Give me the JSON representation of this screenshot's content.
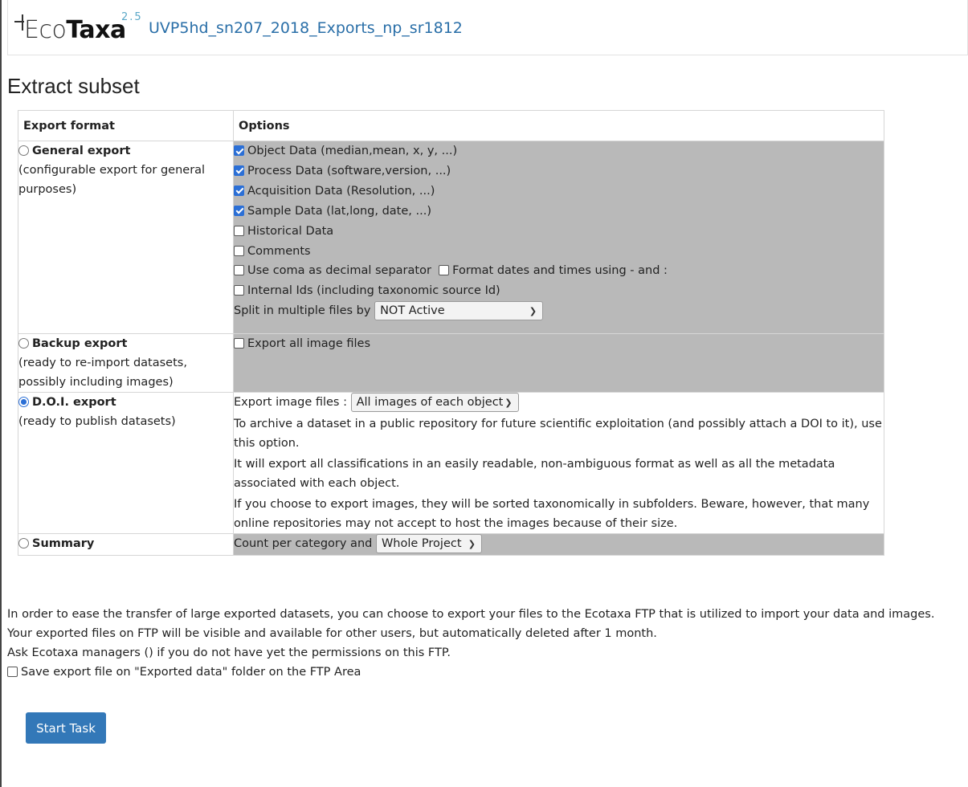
{
  "header": {
    "logo_eco": "Eco",
    "logo_taxa": "Taxa",
    "logo_version": "2.5",
    "project_title": "UVP5hd_sn207_2018_Exports_np_sr1812"
  },
  "page_title": "Extract subset",
  "table": {
    "col_format": "Export format",
    "col_options": "Options"
  },
  "general": {
    "name": "General export",
    "desc": "(configurable export for general purposes)",
    "selected": false,
    "options": [
      {
        "label": "Object Data (median,mean, x, y, ...)",
        "checked": true
      },
      {
        "label": "Process Data (software,version, ...)",
        "checked": true
      },
      {
        "label": "Acquisition Data (Resolution, ...)",
        "checked": true
      },
      {
        "label": "Sample Data (lat,long, date, ...)",
        "checked": true
      },
      {
        "label": "Historical Data",
        "checked": false
      },
      {
        "label": "Comments",
        "checked": false
      }
    ],
    "coma_label": "Use coma as decimal separator",
    "dates_label": "Format dates and times using - and :",
    "internal_ids_label": "Internal Ids (including taxonomic source Id)",
    "split_label": "Split in multiple files by",
    "split_value": "NOT Active"
  },
  "backup": {
    "name": "Backup export",
    "desc": "(ready to re-import datasets, possibly including images)",
    "selected": false,
    "images_label": "Export all image files"
  },
  "doi": {
    "name": "D.O.I. export",
    "desc": "(ready to publish datasets)",
    "selected": true,
    "images_label": "Export image files :",
    "images_value": "All images of each object",
    "text1": "To archive a dataset in a public repository for future scientific exploitation (and possibly attach a DOI to it), use this option.",
    "text2": "It will export all classifications in an easily readable, non-ambiguous format as well as all the metadata associated with each object.",
    "text3": "If you choose to export images, they will be sorted taxonomically in subfolders. Beware, however, that many online repositories may not accept to host the images because of their size."
  },
  "summary": {
    "name": "Summary",
    "selected": false,
    "count_label": "Count per category and",
    "count_value": "Whole Project"
  },
  "ftp": {
    "line1": "In order to ease the transfer of large exported datasets, you can choose to export your files to the Ecotaxa FTP that is utilized to import your data and images.",
    "line2": "Your exported files on FTP will be visible and available for other users, but automatically deleted after 1 month.",
    "line3": "Ask Ecotaxa managers () if you do not have yet the permissions on this FTP.",
    "save_label": "Save export file on \"Exported data\" folder on the FTP Area"
  },
  "start_button": "Start Task",
  "colors": {
    "accent": "#3378b8",
    "link": "#2a6fa8",
    "options_bg": "#b9b9b9",
    "check_blue": "#2b6fd6"
  }
}
